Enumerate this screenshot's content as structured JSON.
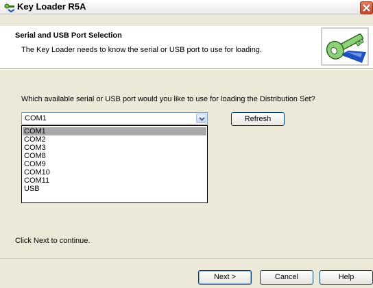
{
  "window": {
    "title": "Key Loader R5A"
  },
  "header": {
    "title": "Serial and USB Port Selection",
    "description": "The Key Loader needs to know the serial or USB port to use for loading."
  },
  "question": "Which available serial or USB port would you like to use for loading the Distribution Set?",
  "port_select": {
    "selected": "COM1",
    "options": [
      "COM1",
      "COM2",
      "COM3",
      "COM8",
      "COM9",
      "COM10",
      "COM11",
      "USB"
    ],
    "expanded": true
  },
  "buttons": {
    "refresh": "Refresh",
    "next": "Next >",
    "cancel": "Cancel",
    "help": "Help"
  },
  "footer_text": "Click Next to continue."
}
